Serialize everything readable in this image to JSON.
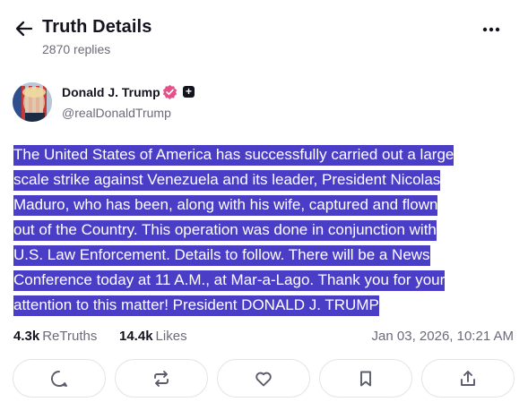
{
  "header": {
    "title": "Truth Details",
    "replies": "2870 replies"
  },
  "author": {
    "name": "Donald J. Trump",
    "handle": "@realDonaldTrump",
    "verified": true
  },
  "post": {
    "lines": [
      "The United States of America has successfully carried out a large",
      "scale strike against Venezuela and its leader, President Nicolas",
      "Maduro, who has been, along with his wife, captured and flown",
      "out of the Country. This operation was done in conjunction with",
      "U.S. Law Enforcement. Details to follow. There will be a News",
      "Conference today at 11 A.M., at Mar-a-Lago. Thank you for your",
      "attention to this matter! President DONALD J. TRUMP"
    ],
    "selection_color": "#4a3ec7"
  },
  "stats": {
    "retruths_count": "4.3k",
    "retruths_label": "ReTruths",
    "likes_count": "14.4k",
    "likes_label": "Likes",
    "date": "Jan 03, 2026, 10:21 AM"
  },
  "actions": [
    {
      "name": "reply",
      "icon": "comment-icon"
    },
    {
      "name": "retruth",
      "icon": "repost-icon"
    },
    {
      "name": "like",
      "icon": "heart-icon"
    },
    {
      "name": "bookmark",
      "icon": "bookmark-icon"
    },
    {
      "name": "share",
      "icon": "share-icon"
    }
  ]
}
